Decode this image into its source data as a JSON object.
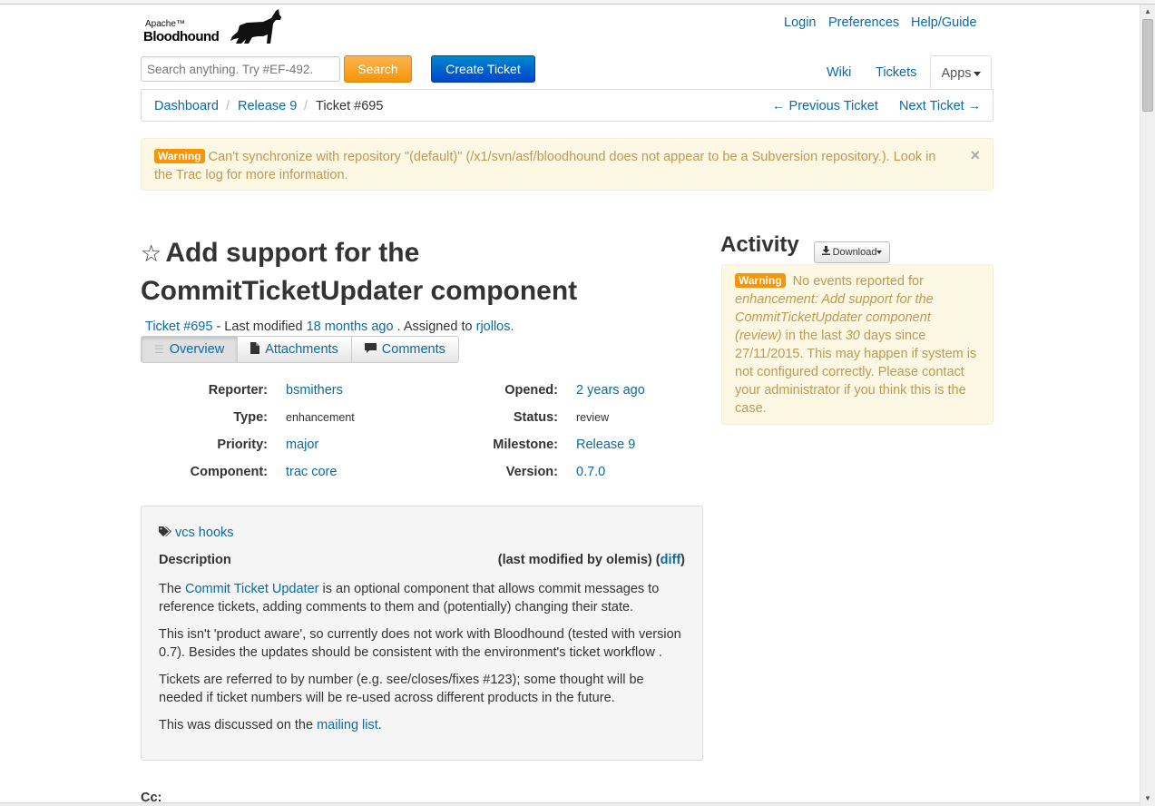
{
  "header": {
    "logo_top": "Apache™",
    "logo_main": "Bloodhound",
    "links": [
      "Login",
      "Preferences",
      "Help/Guide"
    ]
  },
  "search": {
    "placeholder": "Search anything. Try #EF-492.",
    "button": "Search"
  },
  "create_ticket": "Create Ticket",
  "nav": {
    "wiki": "Wiki",
    "tickets": "Tickets",
    "apps": "Apps"
  },
  "breadcrumb": {
    "items": [
      "Dashboard",
      "Release 9",
      "Ticket #695"
    ],
    "prev": "← Previous Ticket",
    "next": "Next Ticket →"
  },
  "warning_top": {
    "label": "Warning",
    "text": "Can't synchronize with repository \"(default)\" (/x1/svn/asf/bloodhound does not appear to be a Subversion repository.). Look in the Trac log for more information.",
    "close": "×"
  },
  "ticket": {
    "star": "☆",
    "title": "Add support for the CommitTicketUpdater component",
    "id_link": "Ticket #695",
    "modified_prefix": " - Last modified ",
    "modified_link": "18 months ago",
    "assigned_prefix": " . Assigned to ",
    "assigned_link": "rjollos.",
    "tabs": [
      "Overview",
      "Attachments",
      "Comments"
    ],
    "props": {
      "reporter_label": "Reporter:",
      "reporter": "bsmithers",
      "type_label": "Type:",
      "type": "enhancement",
      "priority_label": "Priority:",
      "priority": "major",
      "component_label": "Component:",
      "component": "trac core",
      "opened_label": "Opened:",
      "opened": "2 years ago",
      "status_label": "Status:",
      "status": "review",
      "milestone_label": "Milestone:",
      "milestone": "Release 9",
      "version_label": "Version:",
      "version": "0.7.0"
    }
  },
  "description": {
    "tag": "vcs hooks",
    "heading": "Description",
    "modified_open": "(last modified by olemis) (",
    "modified_diff": "diff",
    "modified_close": ")",
    "p1_pre": "The ",
    "p1_link": "Commit Ticket Updater",
    "p1_post": " is an optional component that allows commit messages to reference tickets, adding comments to them and (potentially) changing their state.",
    "p2": "This isn't 'product aware', so currently does not work with Bloodhound (tested with version 0.7). Besides the updates should be consistent with the environment's ticket workflow .",
    "p3": "Tickets are referred to by number (e.g. see/closes/fixes #123); some thought will be needed if ticket numbers will be re-used across different products in the future.",
    "p4_pre": "This was discussed on the ",
    "p4_link": "mailing list",
    "p4_post": "."
  },
  "cc_label": "Cc:",
  "activity": {
    "heading": "Activity",
    "download": "Download",
    "warning_label": "Warning",
    "msg1": "No events reported for ",
    "msg_em": "enhancement: Add support for the CommitTicketUpdater component (review)",
    "msg2": " in the last ",
    "days": "30",
    "msg3": " days since 27/11/2015. This may happen if system is not configured correctly. Please contact your administrator if you think this is the case."
  },
  "colors": {
    "link": "#0a6aa1",
    "warning_bg": "#fcf8e3",
    "warning_text": "#c09853",
    "search_button": "#f89406",
    "create_button": "#0044cc"
  }
}
